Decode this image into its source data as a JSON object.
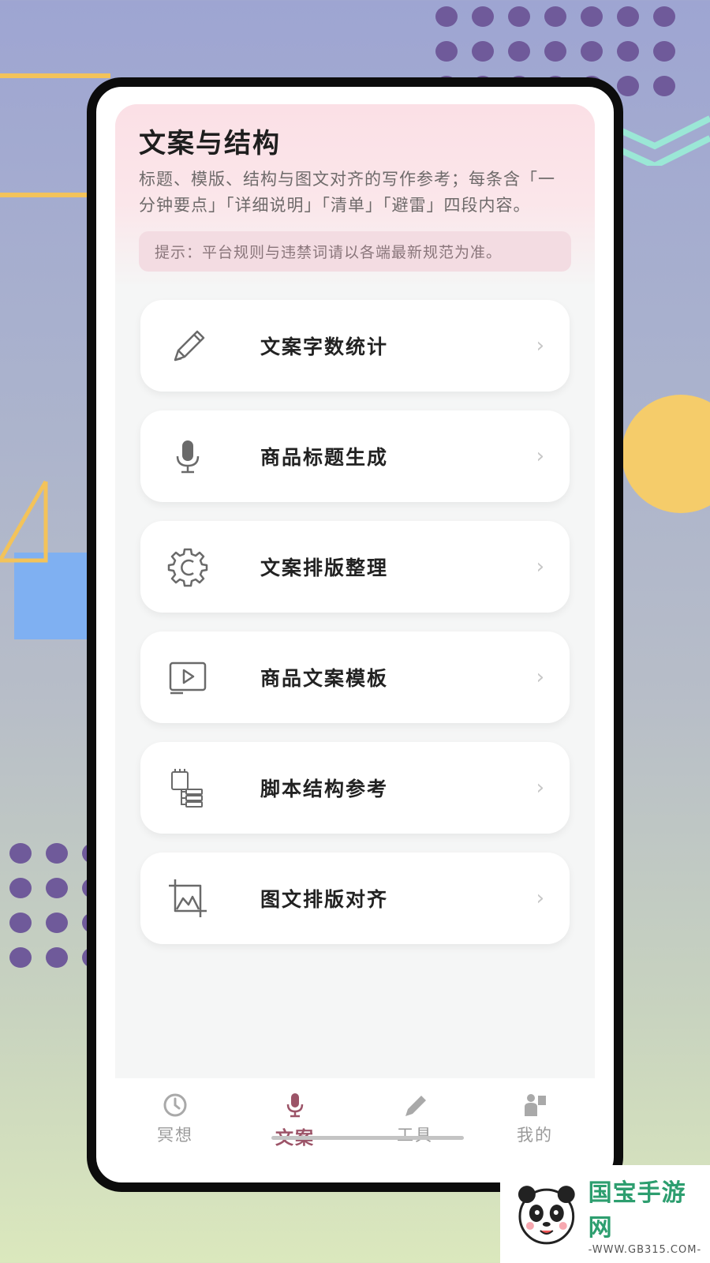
{
  "page": {
    "title": "文案与结构",
    "description": "标题、模版、结构与图文对齐的写作参考；每条含「一分钟要点」「详细说明」「清单」「避雷」四段内容。",
    "tip": "提示：平台规则与违禁词请以各端最新规范为准。"
  },
  "items": [
    {
      "label": "文案字数统计",
      "icon": "pencil-icon"
    },
    {
      "label": "商品标题生成",
      "icon": "microphone-icon"
    },
    {
      "label": "文案排版整理",
      "icon": "gear-icon"
    },
    {
      "label": "商品文案模板",
      "icon": "play-video-icon"
    },
    {
      "label": "脚本结构参考",
      "icon": "list-structure-icon"
    },
    {
      "label": "图文排版对齐",
      "icon": "image-crop-icon"
    }
  ],
  "chevron": "›",
  "tabbar": {
    "tabs": [
      {
        "label": "冥想",
        "icon": "clock-icon",
        "active": false
      },
      {
        "label": "文案",
        "icon": "microphone-icon",
        "active": true
      },
      {
        "label": "工具",
        "icon": "pencil-icon",
        "active": false
      },
      {
        "label": "我的",
        "icon": "person-icon",
        "active": false
      }
    ]
  },
  "watermark": {
    "brand": "国宝手游网",
    "url": "-WWW.GB315.COM-"
  },
  "colors": {
    "accent": "#9c5468",
    "header_pink": "#fbe0e6",
    "tip_bg": "#f3dce2"
  }
}
